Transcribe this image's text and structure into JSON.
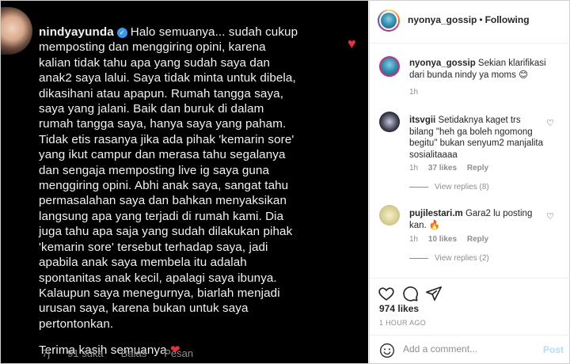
{
  "story": {
    "username": "nindyayunda",
    "verified_mark": "✓",
    "lines": [
      "Halo semuanya... sudah cukup",
      "memposting dan menggiring opini, karena",
      "kalian tidak tahu apa yang sudah saya dan",
      "anak2 saya lalui. Saya tidak minta untuk dibela,",
      "dikasihani atau apapun. Rumah tangga saya,",
      "saya yang jalani. Baik dan buruk di dalam",
      "rumah tangga saya, hanya saya yang paham.",
      "Tidak etis rasanya jika ada pihak 'kemarin sore'",
      "yang ikut campur dan merasa tahu segalanya",
      "dan sengaja memposting live ig saya guna",
      "menggiring opini. Abhi anak saya, sangat tahu",
      "permasalahan saya dan bahkan menyaksikan",
      "langsung apa yang terjadi di rumah kami. Dia",
      "juga tahu apa saja yang sudah dilakukan pihak",
      "'kemarin sore' tersebut terhadap saya, jadi",
      "apabila anak saya membela itu adalah",
      "spontanitas anak kecil, apalagi saya ibunya.",
      "Kalaupun saya menegurnya, biarlah menjadi",
      "urusan saya, karena bukan untuk saya",
      "pertontonkan."
    ],
    "closing": "Terima kasih semuanya",
    "closing_emoji": "❤",
    "time": "7j",
    "likes": "91 suka",
    "reply": "Balas",
    "message": "Pesan",
    "like_icon": "heart-icon",
    "like_glyph": "♥"
  },
  "post": {
    "header": {
      "username": "nyonya_gossip",
      "separator": "•",
      "follow": "Following",
      "more_glyph": "..."
    },
    "caption": {
      "username": "nyonya_gossip",
      "text": "Sekian klarifikasi dari bunda nindy ya moms 😊",
      "time": "1h"
    },
    "comments": [
      {
        "username": "itsvgii",
        "text": "Setidaknya kaget trs bilang \"heh ga boleh ngomong begitu\" bukan senyum2 manjalita sosialitaaaa",
        "time": "1h",
        "likes": "37 likes",
        "reply": "Reply",
        "view_replies": "View replies (8)"
      },
      {
        "username": "pujilestari.m",
        "text": "Gara2 lu posting kan. 🔥",
        "time": "1h",
        "likes": "10 likes",
        "reply": "Reply",
        "view_replies": "View replies (2)"
      }
    ],
    "likes": "974 likes",
    "timestamp": "1 HOUR AGO",
    "add_comment_placeholder": "Add a comment...",
    "post_button": "Post"
  },
  "colors": {
    "story_bg": "#000000",
    "heart_red": "#ed2f3a",
    "verified_blue": "#3897f0",
    "post_blue_disabled": "#b2dffc",
    "muted": "#8e8e8e"
  }
}
